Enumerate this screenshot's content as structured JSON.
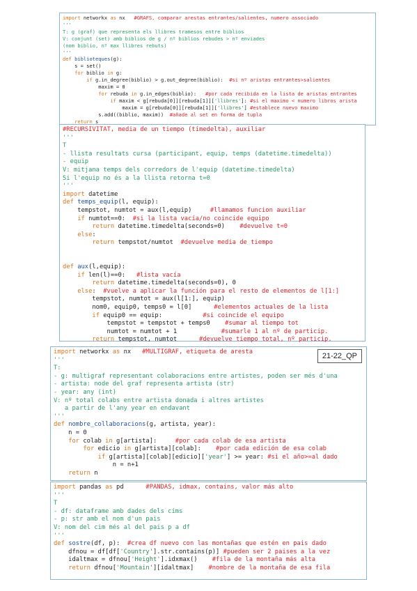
{
  "block1": {
    "lines": [
      "import networkx as nx   #GRAFS, comparar arestas entrantes/salientes, numero associado",
      "'''",
      "T: g (graf) que representa els llibres tramesos entre biblios",
      "V: conjunt (set) amb biblios de g / nº biblios rebudes > nº enviades",
      "(nom biblio, nº max llibres rebuts)",
      "'''",
      "def biblioteques(g):",
      "    s = set()",
      "    for biblio in g:",
      "        if g.in_degree(biblio) > g.out_degree(biblio):  #si nº aristas entrantes>salientes",
      "            maxim = 0",
      "            for rebuda in g.in_edges(biblio):   #por cada recibida en la lista de aristas entrantes",
      "                if maxim < g[rebuda[0]][rebuda[1]]['llibres']: #si el maximo < numero libros arista",
      "                    maxim = g[rebuda[0]][rebuda[1]]['llibres'] #establece nuevo maximo",
      "            s.add((biblio, maxim))  #añade al set en forma de tupla",
      "    return s"
    ]
  },
  "block2": {
    "lines": [
      "#RECURSIVITAT, media de un tiempo (timedelta), auxiliar",
      "'''",
      "T",
      "- llista resultats cursa (participant, equip, temps (datetime.timedelta))",
      "- equip",
      "V: mitjana temps dels corredors de l'equip (datetime.timedelta)",
      "Si l'equip no és a la llista retorna t=0",
      "'''",
      "import datetime",
      "def temps_equip(l, equip):",
      "    tempstot, numtot = aux(l,equip)     #llamamos funcion auxiliar",
      "    if numtot==0:  #si la lista vacía/no coincide equipo",
      "        return datetime.timedelta(seconds=0)    #devuelve t=0",
      "    else:",
      "        return tempstot/numtot  #devuelve media de tiempo",
      "",
      "",
      "def aux(l,equip):",
      "    if len(l)==0:   #lista vacía",
      "        return datetime.timedelta(seconds=0), 0",
      "    else:  #vuelve a aplicar la función para el resto de elementos de l[1:]",
      "        tempstot, numtot = aux(l[1:], equip)",
      "        nom0, equip0, temps0 = l[0]      #elementos actuales de la lista",
      "        if equip0 == equip:           #si coincide el equipo",
      "            tempstot = tempstot + temps0    #sumar al tiempo tot",
      "            numtot = numtot + 1            #sumarle 1 al nº de particip.",
      "        return tempstot, numtot      #devuelve tiempo total, nº particip."
    ]
  },
  "block3": {
    "badge": "21-22_QP",
    "lines": [
      "import networkx as nx   #MULTIGRAF, etiqueta de aresta",
      "'''",
      "T:",
      "- g: multigraf representant colaboracions entre artistes, poden ser més d'una",
      "- artista: node del graf representa artista (str)",
      "- year: any (int)",
      "V: nº total colabs entre artista donada i altres artistes",
      "   a partir de l'any year en endavant",
      "'''",
      "def nombre_collaboracions(g, artista, year):",
      "    n = 0",
      "    for colab in g[artista]:     #por cada colab de esa artista",
      "        for edicio in g[artista][colab]:    #por cada edición de esa colab",
      "            if g[artista][colab][edicio]['year'] >= year: #si el año>=al dado",
      "                n = n+1",
      "    return n"
    ]
  },
  "block4": {
    "lines": [
      "import pandas as pd      #PANDAS, idmax, contains, valor más alto",
      "'''",
      "T",
      "- df: dataframe amb dades dels cims",
      "- p: str amb el nom d'un pais",
      "V: nom del cim més al del pais p a df",
      "'''",
      "def sostre(df, p):  #crea df nuevo con las montañas que estén en pais dado",
      "    dfnou = df[df['Country'].str.contains(p)] #pueden ser 2 paises a la vez",
      "    idaltmax = dfnou['Height'].idxmax()    #fila de la montaña más alta",
      "    return dfnou['Mountain'][idaltmax]    #nombre de la montaña de esa fila"
    ]
  }
}
